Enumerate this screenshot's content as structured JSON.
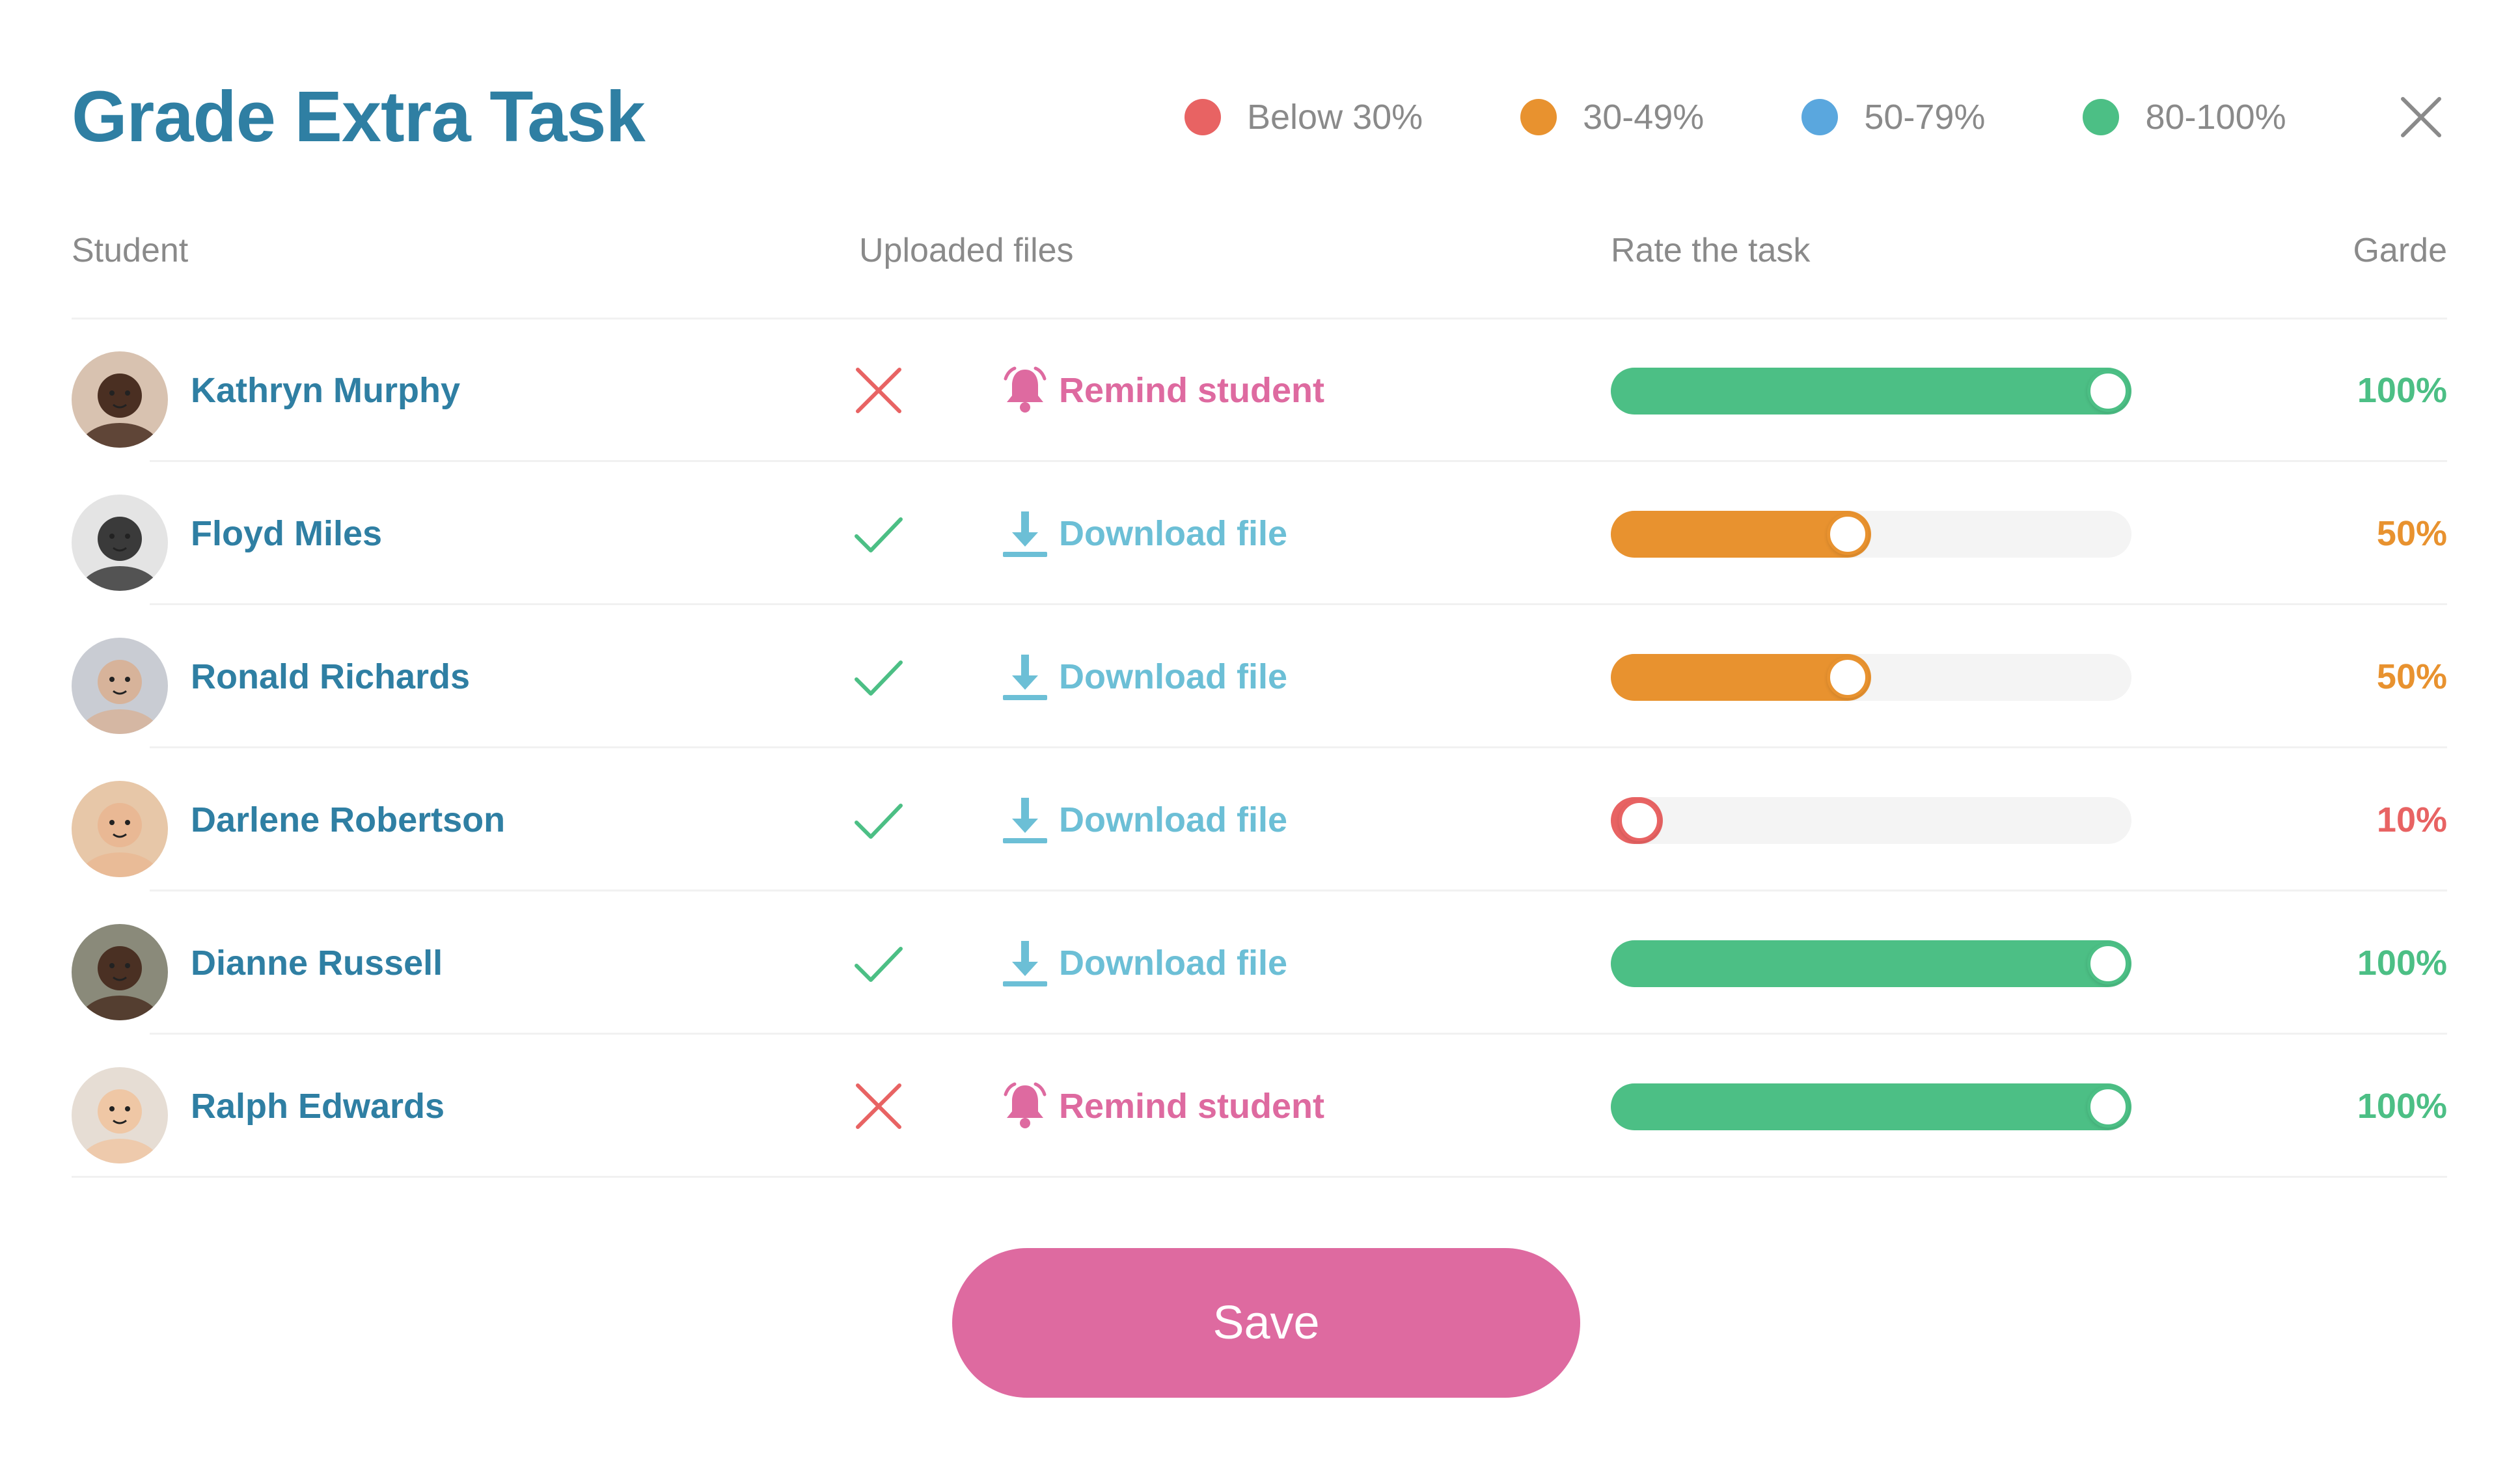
{
  "modal": {
    "title": "Grade Extra Task"
  },
  "legend": [
    {
      "label": "Below 30%",
      "color": "#e86363"
    },
    {
      "label": "30-49%",
      "color": "#e8922f"
    },
    {
      "label": "50-79%",
      "color": "#5aa7de"
    },
    {
      "label": "80-100%",
      "color": "#4cbf85"
    }
  ],
  "columns": {
    "student": "Student",
    "uploaded_files": "Uploaded files",
    "rate": "Rate the task",
    "grade": "Garde"
  },
  "icons": {
    "close": "close-icon",
    "missing": "cross-icon",
    "uploaded": "check-icon",
    "remind": "bell-icon",
    "download": "download-icon"
  },
  "students": [
    {
      "name": "Kathryn Murphy",
      "uploaded": false,
      "action": "Remind student",
      "rating": 1.0,
      "grade": "100%",
      "grade_color": "#4cbf85",
      "avatar_bg": "#d8c2b0",
      "avatar_skin": "#4a2f22"
    },
    {
      "name": "Floyd Miles",
      "uploaded": true,
      "action": "Download file",
      "rating": 0.5,
      "grade": "50%",
      "grade_color": "#e8922f",
      "avatar_bg": "#e4e4e4",
      "avatar_skin": "#3a3a3a"
    },
    {
      "name": "Ronald Richards",
      "uploaded": true,
      "action": "Download file",
      "rating": 0.5,
      "grade": "50%",
      "grade_color": "#e8922f",
      "avatar_bg": "#c9ccd3",
      "avatar_skin": "#d7b39a"
    },
    {
      "name": "Darlene Robertson",
      "uploaded": true,
      "action": "Download file",
      "rating": 0.1,
      "grade": "10%",
      "grade_color": "#e86363",
      "avatar_bg": "#e7c7a8",
      "avatar_skin": "#e9b894"
    },
    {
      "name": "Dianne Russell",
      "uploaded": true,
      "action": "Download file",
      "rating": 1.0,
      "grade": "100%",
      "grade_color": "#4cbf85",
      "avatar_bg": "#8a8a7a",
      "avatar_skin": "#4a3023"
    },
    {
      "name": "Ralph Edwards",
      "uploaded": false,
      "action": "Remind student",
      "rating": 1.0,
      "grade": "100%",
      "grade_color": "#4cbf85",
      "avatar_bg": "#e6ddd4",
      "avatar_skin": "#efc7a5"
    }
  ],
  "colors": {
    "title": "#2f7fa3",
    "remind": "#de6aa0",
    "download": "#6cbfd6",
    "check": "#4cbf85",
    "cross": "#e86363",
    "track": "#f4f4f4",
    "save_button": "#de6aa0"
  },
  "save_button": {
    "label": "Save"
  }
}
